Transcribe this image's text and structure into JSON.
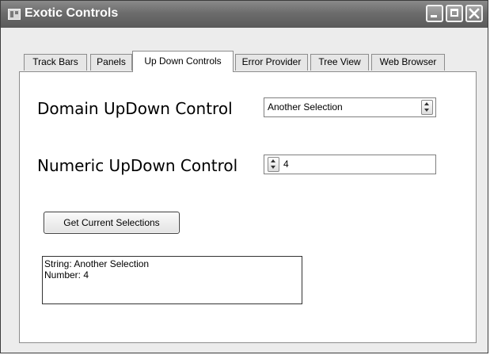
{
  "window": {
    "title": "Exotic Controls",
    "icon": "form-app-icon",
    "buttons": [
      "minimize",
      "maximize",
      "close"
    ]
  },
  "tabs": [
    {
      "label": "Track Bars",
      "active": false
    },
    {
      "label": "Panels",
      "active": false
    },
    {
      "label": "Up Down Controls",
      "active": true
    },
    {
      "label": "Error Provider",
      "active": false
    },
    {
      "label": "Tree View",
      "active": false
    },
    {
      "label": "Web Browser",
      "active": false
    }
  ],
  "domain": {
    "label": "Domain UpDown Control",
    "value": "Another Selection"
  },
  "numeric": {
    "label": "Numeric UpDown Control",
    "value": "4"
  },
  "action": {
    "button_label": "Get Current Selections"
  },
  "output": {
    "line1": "String: Another Selection",
    "line2": "Number: 4"
  }
}
